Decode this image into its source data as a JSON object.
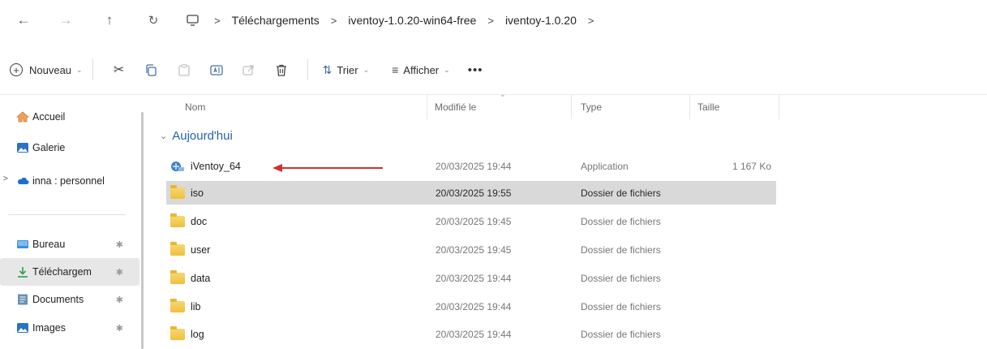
{
  "address": {
    "back_icon": "arrow-left-icon",
    "forward_icon": "arrow-right-icon",
    "up_icon": "arrow-up-icon",
    "refresh_icon": "refresh-icon",
    "monitor_icon": "monitor-icon",
    "breadcrumbs": [
      "Téléchargements",
      "iventoy-1.0.20-win64-free",
      "iventoy-1.0.20"
    ]
  },
  "toolbar": {
    "new_label": "Nouveau",
    "sort_label": "Trier",
    "view_label": "Afficher",
    "more_label": "•••",
    "tools": [
      "cut-icon",
      "copy-icon",
      "paste-icon",
      "rename-icon",
      "share-icon",
      "delete-icon"
    ]
  },
  "sidebar": {
    "items": [
      {
        "label": "Accueil",
        "icon": "home-icon"
      },
      {
        "label": "Galerie",
        "icon": "gallery-icon"
      },
      {
        "label": "inna : personnel",
        "icon": "cloud-icon"
      },
      {
        "label": "Bureau",
        "icon": "desktop-icon"
      },
      {
        "label": "Téléchargem",
        "icon": "download-icon"
      },
      {
        "label": "Documents",
        "icon": "documents-icon"
      },
      {
        "label": "Images",
        "icon": "images-icon"
      }
    ]
  },
  "columns": {
    "name": "Nom",
    "modified": "Modifié le",
    "type": "Type",
    "size": "Taille"
  },
  "group_label": "Aujourd'hui",
  "files": [
    {
      "name": "iVentoy_64",
      "date": "20/03/2025 19:44",
      "type": "Application",
      "size": "1 167 Ko"
    },
    {
      "name": "iso",
      "date": "20/03/2025 19:55",
      "type": "Dossier de fichiers",
      "size": ""
    },
    {
      "name": "doc",
      "date": "20/03/2025 19:45",
      "type": "Dossier de fichiers",
      "size": ""
    },
    {
      "name": "user",
      "date": "20/03/2025 19:45",
      "type": "Dossier de fichiers",
      "size": ""
    },
    {
      "name": "data",
      "date": "20/03/2025 19:44",
      "type": "Dossier de fichiers",
      "size": ""
    },
    {
      "name": "lib",
      "date": "20/03/2025 19:44",
      "type": "Dossier de fichiers",
      "size": ""
    },
    {
      "name": "log",
      "date": "20/03/2025 19:44",
      "type": "Dossier de fichiers",
      "size": ""
    }
  ],
  "colors": {
    "accent": "#2463b0",
    "annotation_arrow": "#d32f2f",
    "selected_row": "#d9d9d9",
    "folder": "#eec03c"
  }
}
